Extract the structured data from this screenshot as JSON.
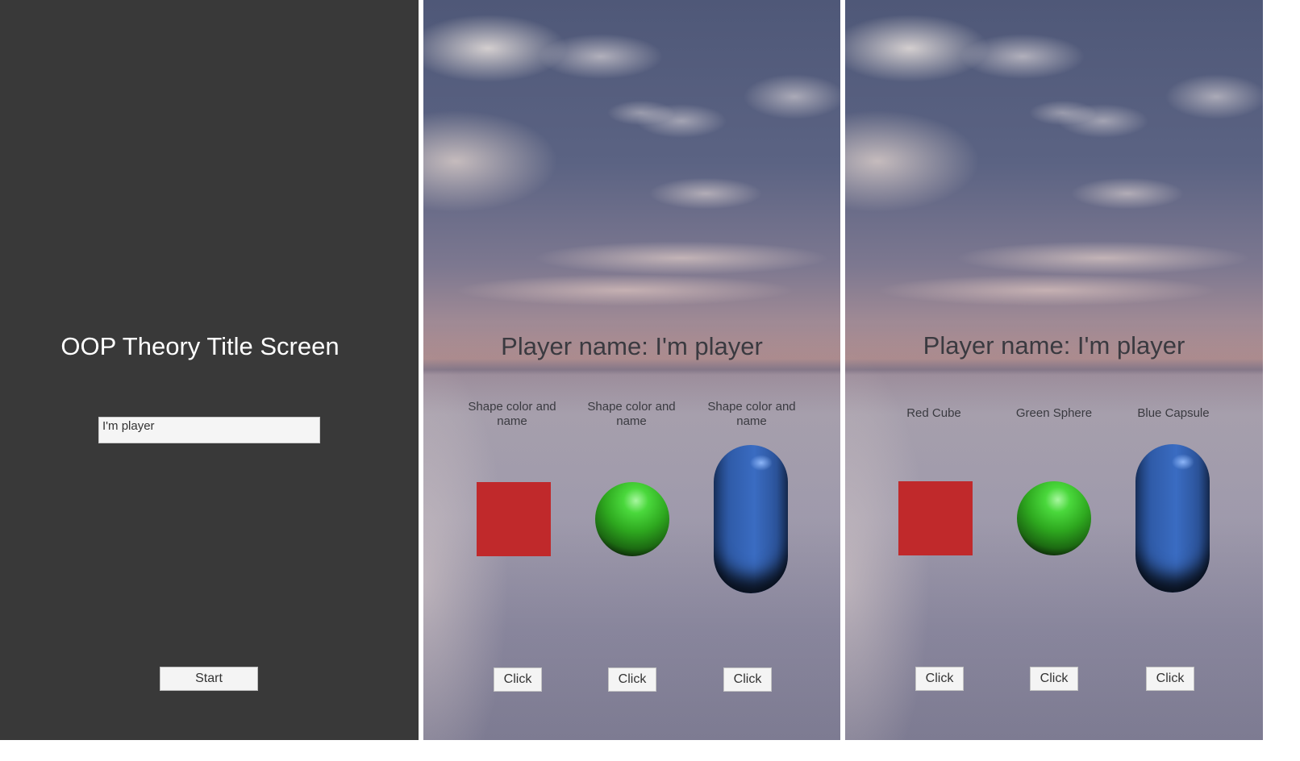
{
  "title_screen": {
    "title": "OOP Theory Title Screen",
    "name_input_value": "I'm player",
    "start_label": "Start",
    "background": "#393939"
  },
  "scene_initial": {
    "player_name": "Player name: I'm player",
    "shapes": [
      {
        "label": "Shape color and name",
        "shape": "cube",
        "color": "#c0292b",
        "button": "Click"
      },
      {
        "label": "Shape color and name",
        "shape": "sphere",
        "color": "#3ec92f",
        "button": "Click"
      },
      {
        "label": "Shape color and name",
        "shape": "capsule",
        "color": "#3563b5",
        "button": "Click"
      }
    ]
  },
  "scene_clicked": {
    "player_name": "Player name: I'm player",
    "shapes": [
      {
        "label": "Red Cube",
        "shape": "cube",
        "color": "#c0292b",
        "button": "Click"
      },
      {
        "label": "Green Sphere",
        "shape": "sphere",
        "color": "#3ec92f",
        "button": "Click"
      },
      {
        "label": "Blue Capsule",
        "shape": "capsule",
        "color": "#3563b5",
        "button": "Click"
      }
    ]
  }
}
